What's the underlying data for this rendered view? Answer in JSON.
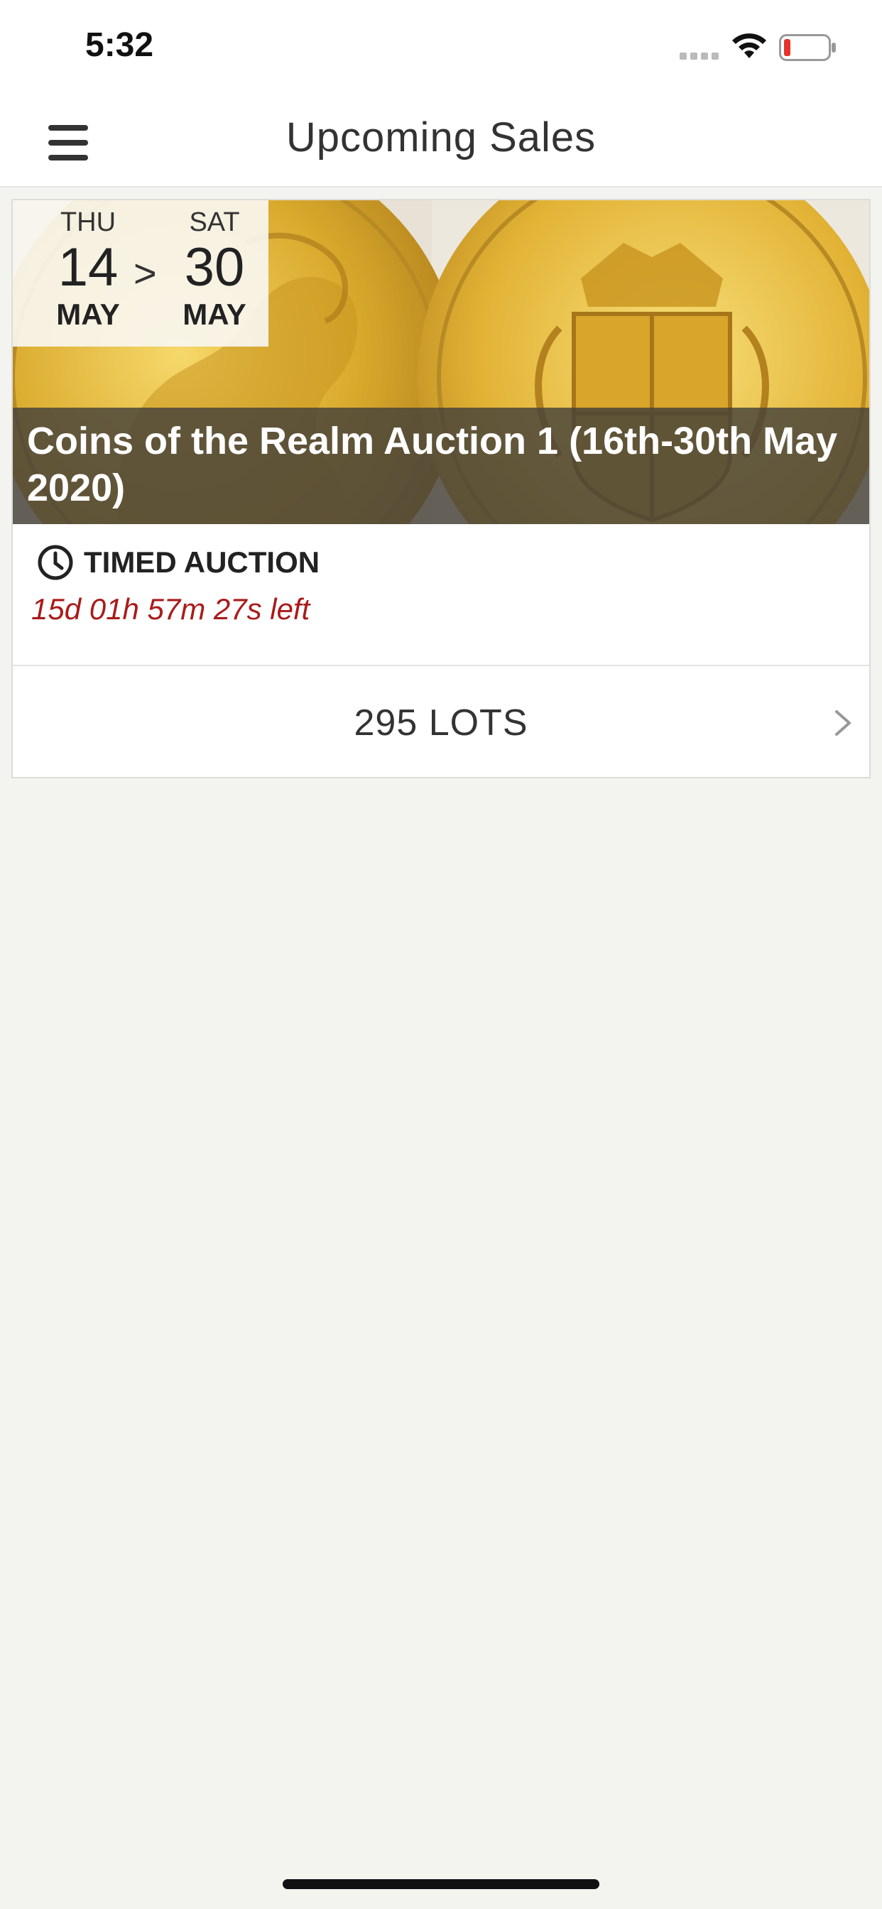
{
  "status_bar": {
    "time": "5:32"
  },
  "header": {
    "title": "Upcoming Sales"
  },
  "sale": {
    "start": {
      "weekday": "THU",
      "day": "14",
      "month": "MAY"
    },
    "separator": ">",
    "end": {
      "weekday": "SAT",
      "day": "30",
      "month": "MAY"
    },
    "title": "Coins of the Realm Auction 1 (16th-30th May 2020)",
    "auction_type": "TIMED AUCTION",
    "time_left": "15d 01h 57m 27s left",
    "lots_label": "295 LOTS"
  },
  "colors": {
    "accent_red": "#a91b1b",
    "title_band": "#46423a",
    "page_bg": "#f3f3f0"
  },
  "icons": [
    "menu-icon",
    "clock-icon",
    "chevron-right-icon",
    "wifi-icon",
    "battery-icon",
    "signal-icon"
  ]
}
